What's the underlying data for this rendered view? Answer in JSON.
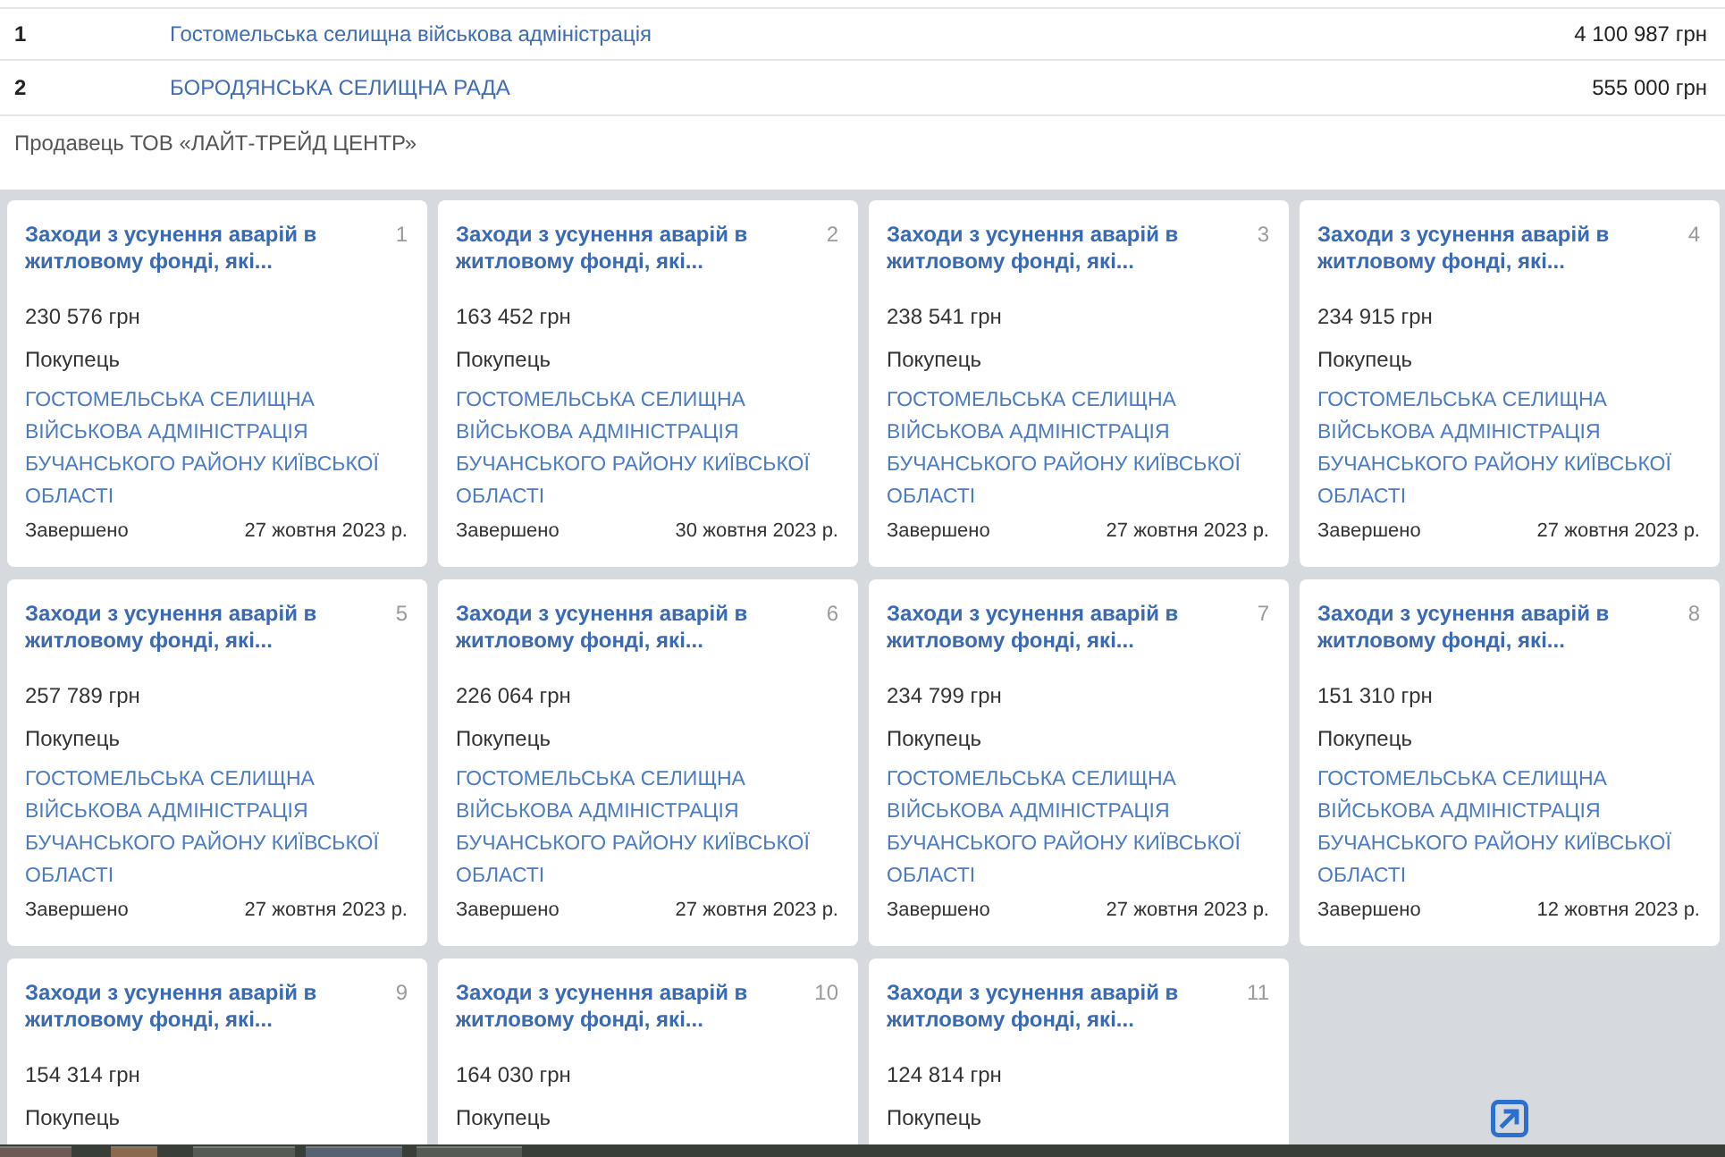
{
  "buyers_table": {
    "rows": [
      {
        "number": "1",
        "name": "Гостомельська селищна військова адміністрація",
        "amount": "4 100 987 грн"
      },
      {
        "number": "2",
        "name": "БОРОДЯНСЬКА СЕЛИЩНА РАДА",
        "amount": "555 000 грн"
      }
    ]
  },
  "seller": "Продавець ТОВ «ЛАЙТ-ТРЕЙД ЦЕНТР»",
  "contracts": [
    {
      "title": "Заходи з усунення аварій в житловому фонді, які...",
      "number": "1",
      "amount": "230 576 грн",
      "buyer_label": "Покупець",
      "buyer": "ГОСТОМЕЛЬСЬКА СЕЛИЩНА ВІЙСЬКОВА АДМІНІСТРАЦІЯ БУЧАНСЬКОГО РАЙОНУ КИЇВСЬКОЇ ОБЛАСТІ",
      "status": "Завершено",
      "date": "27 жовтня 2023 р."
    },
    {
      "title": "Заходи з усунення аварій в житловому фонді, які...",
      "number": "2",
      "amount": "163 452 грн",
      "buyer_label": "Покупець",
      "buyer": "ГОСТОМЕЛЬСЬКА СЕЛИЩНА ВІЙСЬКОВА АДМІНІСТРАЦІЯ БУЧАНСЬКОГО РАЙОНУ КИЇВСЬКОЇ ОБЛАСТІ",
      "status": "Завершено",
      "date": "30 жовтня 2023 р."
    },
    {
      "title": "Заходи з усунення аварій в житловому фонді, які...",
      "number": "3",
      "amount": "238 541 грн",
      "buyer_label": "Покупець",
      "buyer": "ГОСТОМЕЛЬСЬКА СЕЛИЩНА ВІЙСЬКОВА АДМІНІСТРАЦІЯ БУЧАНСЬКОГО РАЙОНУ КИЇВСЬКОЇ ОБЛАСТІ",
      "status": "Завершено",
      "date": "27 жовтня 2023 р."
    },
    {
      "title": "Заходи з усунення аварій в житловому фонді, які...",
      "number": "4",
      "amount": "234 915 грн",
      "buyer_label": "Покупець",
      "buyer": "ГОСТОМЕЛЬСЬКА СЕЛИЩНА ВІЙСЬКОВА АДМІНІСТРАЦІЯ БУЧАНСЬКОГО РАЙОНУ КИЇВСЬКОЇ ОБЛАСТІ",
      "status": "Завершено",
      "date": "27 жовтня 2023 р."
    },
    {
      "title": "Заходи з усунення аварій в житловому фонді, які...",
      "number": "5",
      "amount": "257 789 грн",
      "buyer_label": "Покупець",
      "buyer": "ГОСТОМЕЛЬСЬКА СЕЛИЩНА ВІЙСЬКОВА АДМІНІСТРАЦІЯ БУЧАНСЬКОГО РАЙОНУ КИЇВСЬКОЇ ОБЛАСТІ",
      "status": "Завершено",
      "date": "27 жовтня 2023 р."
    },
    {
      "title": "Заходи з усунення аварій в житловому фонді, які...",
      "number": "6",
      "amount": "226 064 грн",
      "buyer_label": "Покупець",
      "buyer": "ГОСТОМЕЛЬСЬКА СЕЛИЩНА ВІЙСЬКОВА АДМІНІСТРАЦІЯ БУЧАНСЬКОГО РАЙОНУ КИЇВСЬКОЇ ОБЛАСТІ",
      "status": "Завершено",
      "date": "27 жовтня 2023 р."
    },
    {
      "title": "Заходи з усунення аварій в житловому фонді, які...",
      "number": "7",
      "amount": "234 799 грн",
      "buyer_label": "Покупець",
      "buyer": "ГОСТОМЕЛЬСЬКА СЕЛИЩНА ВІЙСЬКОВА АДМІНІСТРАЦІЯ БУЧАНСЬКОГО РАЙОНУ КИЇВСЬКОЇ ОБЛАСТІ",
      "status": "Завершено",
      "date": "27 жовтня 2023 р."
    },
    {
      "title": "Заходи з усунення аварій в житловому фонді, які...",
      "number": "8",
      "amount": "151 310 грн",
      "buyer_label": "Покупець",
      "buyer": "ГОСТОМЕЛЬСЬКА СЕЛИЩНА ВІЙСЬКОВА АДМІНІСТРАЦІЯ БУЧАНСЬКОГО РАЙОНУ КИЇВСЬКОЇ ОБЛАСТІ",
      "status": "Завершено",
      "date": "12 жовтня 2023 р."
    },
    {
      "title": "Заходи з усунення аварій в житловому фонді, які...",
      "number": "9",
      "amount": "154 314 грн",
      "buyer_label": "Покупець"
    },
    {
      "title": "Заходи з усунення аварій в житловому фонді, які...",
      "number": "10",
      "amount": "164 030 грн",
      "buyer_label": "Покупець"
    },
    {
      "title": "Заходи з усунення аварій в житловому фонді, які...",
      "number": "11",
      "amount": "124 814 грн",
      "buyer_label": "Покупець"
    }
  ]
}
